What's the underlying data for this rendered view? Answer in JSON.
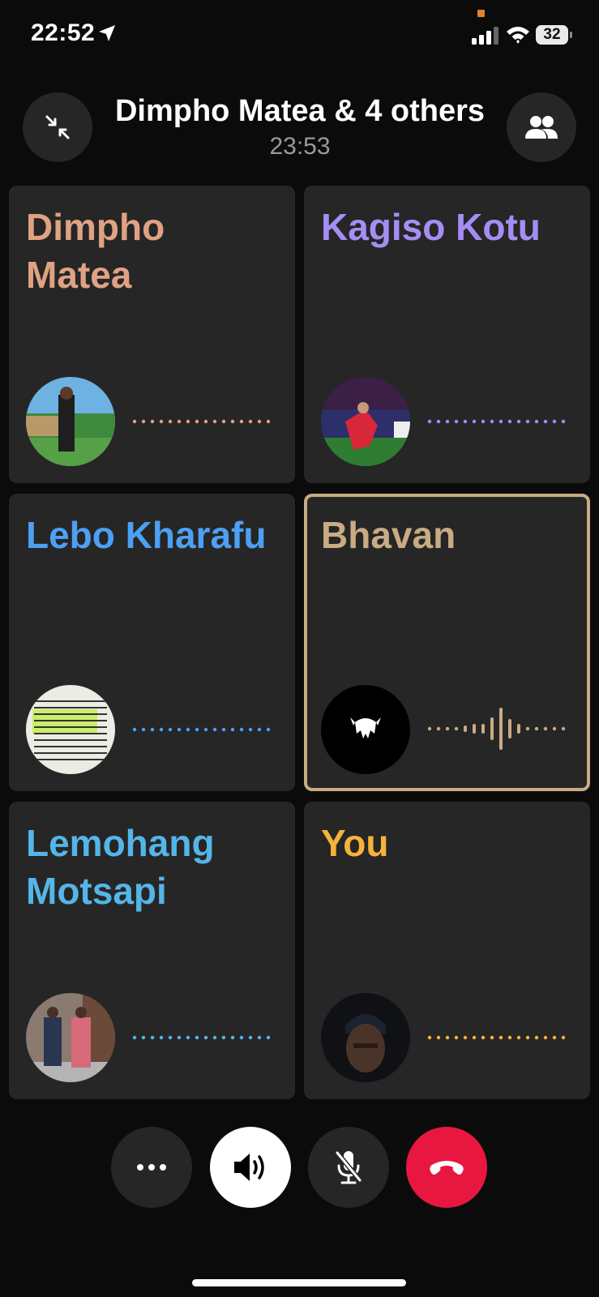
{
  "status_bar": {
    "time": "22:52",
    "battery": "32",
    "icons": [
      "location-arrow-icon",
      "signal-icon",
      "wifi-icon",
      "battery-icon"
    ]
  },
  "header": {
    "title": "Dimpho Matea & 4 others",
    "call_time": "23:53",
    "left_icon": "minimize-icon",
    "right_icon": "participants-icon"
  },
  "participants": [
    {
      "name": "Dimpho Matea",
      "color": "#dfa283",
      "speaking": false
    },
    {
      "name": "Kagiso Kotu",
      "color": "#a48ef4",
      "speaking": false
    },
    {
      "name": "Lebo Kharafu",
      "color": "#4da0f3",
      "speaking": false
    },
    {
      "name": "Bhavan",
      "color": "#c9ab84",
      "speaking": true
    },
    {
      "name": "Lemohang Motsapi",
      "color": "#54b5e8",
      "speaking": false
    },
    {
      "name": "You",
      "color": "#f6b23a",
      "speaking": false
    }
  ],
  "controls": {
    "more_icon": "more-icon",
    "speaker_icon": "speaker-icon",
    "mic_icon": "mic-muted-icon",
    "end_icon": "end-call-icon",
    "end_color": "#e8173f"
  }
}
